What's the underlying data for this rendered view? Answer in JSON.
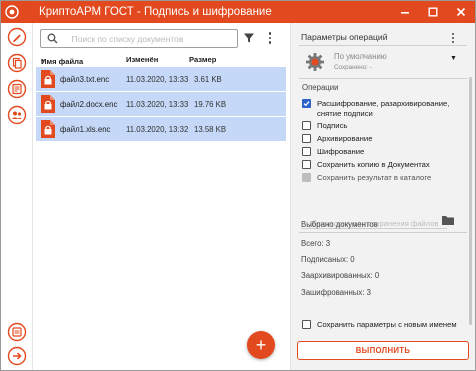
{
  "window": {
    "title": "КриптоАРМ ГОСТ - Подпись и шифрование",
    "accent_color": "#e3491f",
    "controls": [
      "minimize-icon",
      "maximize-icon",
      "close-icon"
    ]
  },
  "sidebar": {
    "top_icons": [
      "sign-icon",
      "documents-icon",
      "certificates-icon",
      "contacts-icon"
    ],
    "bottom_icons": [
      "help-icon",
      "exit-icon"
    ]
  },
  "documents": {
    "search_placeholder": "Поиск по списку документов",
    "columns": {
      "name": "Имя файла",
      "sort_marker": "*",
      "modified": "Изменён",
      "size": "Размер"
    },
    "rows": [
      {
        "name": "файл3.txt.enc",
        "modified": "11.03.2020, 13:33",
        "size": "3.61 KB"
      },
      {
        "name": "файл2.docx.enc",
        "modified": "11.03.2020, 13:33",
        "size": "19.76 KB"
      },
      {
        "name": "файл1.xls.enc",
        "modified": "11.03.2020, 13:32",
        "size": "13.58 KB"
      }
    ],
    "add_button": "+"
  },
  "operations_panel": {
    "header": "Параметры операций",
    "profile": {
      "name": "По умолчанию",
      "saved": "Сохранено: -",
      "dropdown_arrow": "▼"
    },
    "operations_title": "Операции",
    "operations": [
      {
        "label": "Расшифрование, разархивирование, снятие подписи",
        "checked": true,
        "disabled": false
      },
      {
        "label": "Подпись",
        "checked": false,
        "disabled": false
      },
      {
        "label": "Архивирование",
        "checked": false,
        "disabled": false
      },
      {
        "label": "Шифрование",
        "checked": false,
        "disabled": false
      },
      {
        "label": "Сохранить копию в Документах",
        "checked": false,
        "disabled": false
      },
      {
        "label": "Сохранить результат в каталоге",
        "checked": false,
        "disabled": true
      }
    ],
    "dir_placeholder": "Директория для сохранения файлов",
    "selected_title": "Выбрано документов",
    "stats": {
      "total": "Всего: 3",
      "signed": "Подписаных: 0",
      "archived": "Заархивированных: 0",
      "encrypted": "Зашифрованных: 3"
    },
    "save_params_label": "Сохранить параметры с новым именем",
    "execute_label": "ВЫПОЛНИТЬ"
  }
}
